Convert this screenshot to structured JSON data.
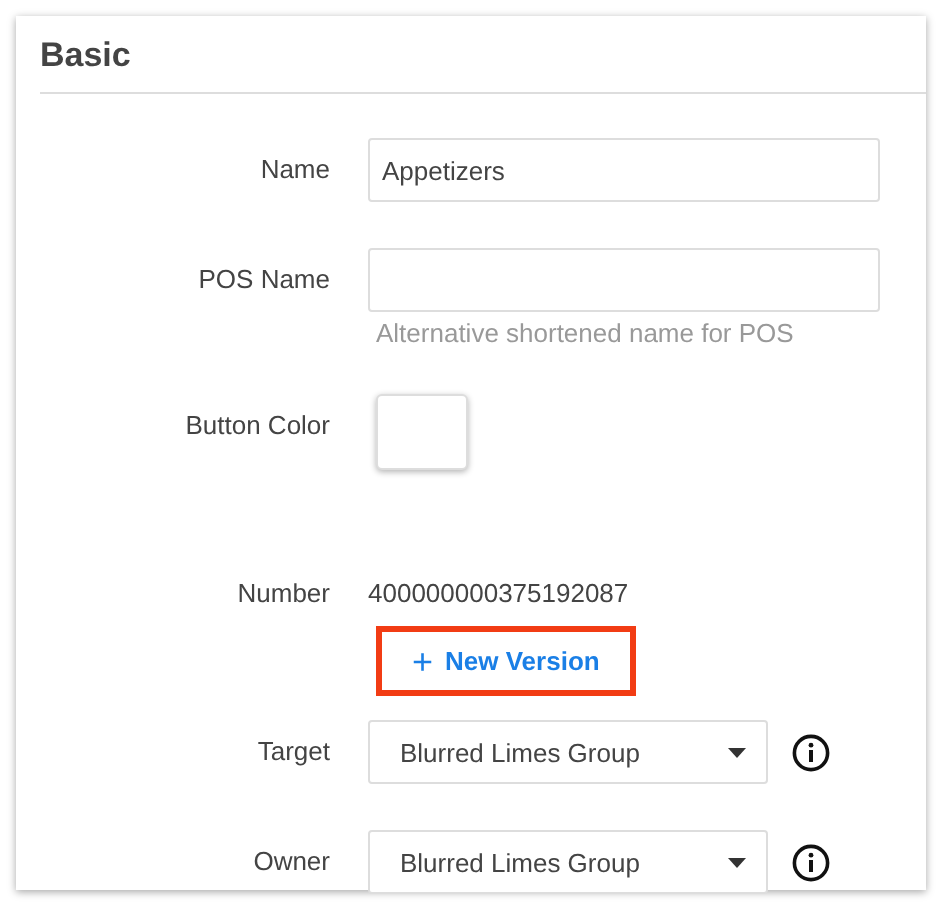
{
  "section": {
    "title": "Basic"
  },
  "fields": [
    {
      "kind": "text",
      "label": "Name",
      "value": "Appetizers"
    },
    {
      "kind": "text",
      "label": "POS Name",
      "hint": "Alternative shortened name for POS"
    },
    {
      "kind": "color",
      "label": "Button Color",
      "color": "#ffffff"
    },
    {
      "kind": "number",
      "label": "Number",
      "value": "400000000375192087",
      "button": {
        "label": "New Version",
        "icon": "+",
        "highlighted": true
      }
    },
    {
      "kind": "select",
      "label": "Target",
      "value": "Blurred Limes Group"
    },
    {
      "kind": "select",
      "label": "Owner",
      "value": "Blurred Limes Group"
    }
  ]
}
